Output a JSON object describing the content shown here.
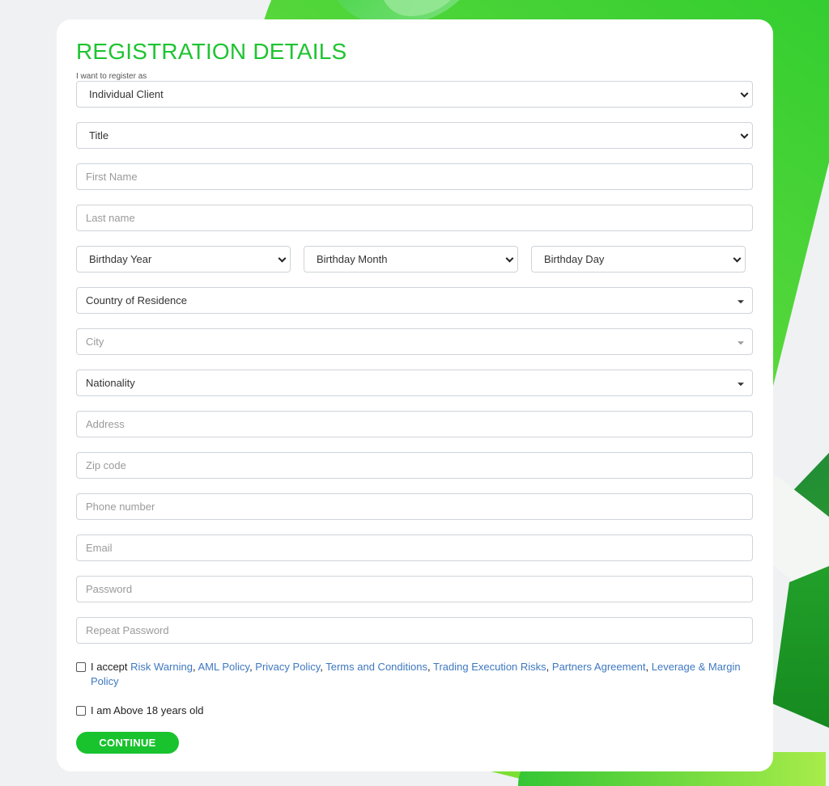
{
  "form": {
    "title": "REGISTRATION DETAILS",
    "register_as_label": "I want to register as",
    "register_as_value": "Individual Client",
    "title_select": "Title",
    "first_name_placeholder": "First Name",
    "last_name_placeholder": "Last name",
    "birthday_year": "Birthday Year",
    "birthday_month": "Birthday Month",
    "birthday_day": "Birthday Day",
    "country": "Country of Residence",
    "city": "City",
    "nationality": "Nationality",
    "address_placeholder": "Address",
    "zip_placeholder": "Zip code",
    "phone_placeholder": "Phone number",
    "email_placeholder": "Email",
    "password_placeholder": "Password",
    "repeat_password_placeholder": "Repeat Password"
  },
  "consent": {
    "prefix": "I accept ",
    "links": [
      "Risk Warning",
      "AML Policy",
      "Privacy Policy",
      "Terms and Conditions",
      "Trading Execution Risks",
      "Partners Agreement",
      "Leverage & Margin Policy"
    ],
    "sep": ", ",
    "age_label": "I am Above 18 years old"
  },
  "actions": {
    "continue_label": "CONTINUE"
  },
  "colors": {
    "accent": "#1ec431",
    "link": "#3f78c0",
    "button": "#18c32e"
  }
}
